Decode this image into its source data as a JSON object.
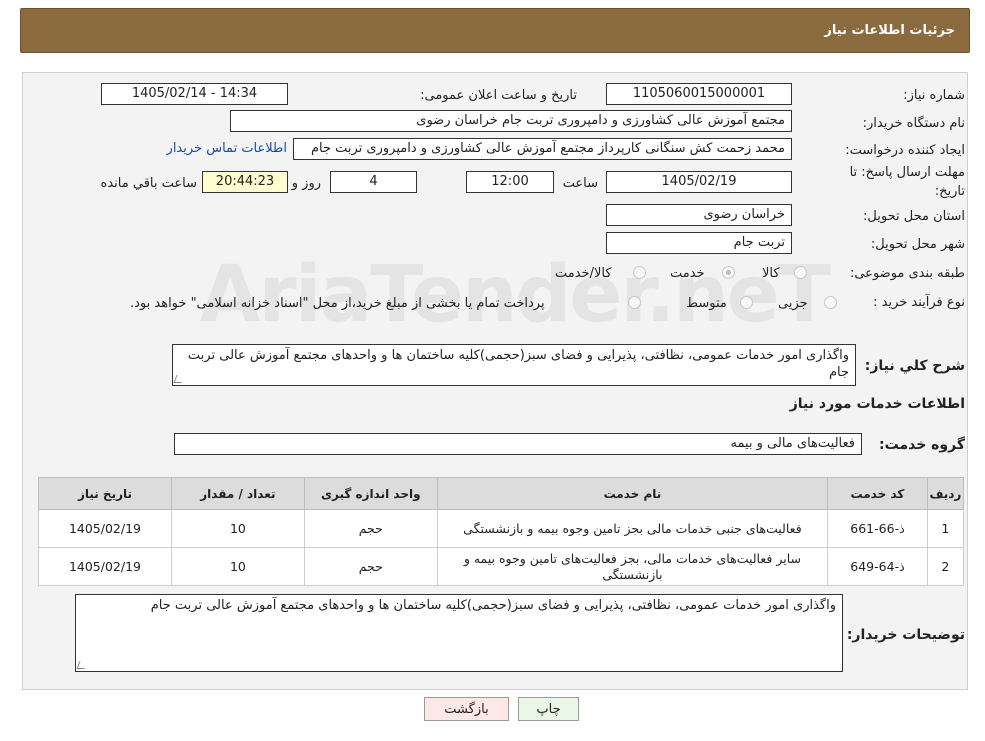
{
  "header": {
    "title": "جزئیات اطلاعات نیاز"
  },
  "fields": {
    "need_number_label": "شماره نیاز:",
    "need_number": "1105060015000001",
    "announce_label": "تاریخ و ساعت اعلان عمومی:",
    "announce_value": "1405/02/14 - 14:34",
    "buyer_label": "نام دستگاه خریدار:",
    "buyer_value": "مجتمع آموزش عالی کشاورزی و دامپروری تربت جام خراسان رضوی",
    "requester_label": "ایجاد کننده درخواست:",
    "requester_value": "محمد زحمت کش سنگانی کارپرداز مجتمع آموزش عالی کشاورزی و دامپروری تربت جام",
    "contact_link": "اطلاعات تماس خریدار",
    "deadline_label_1": "مهلت ارسال پاسخ: تا",
    "deadline_label_2": "تاریخ:",
    "deadline_date": "1405/02/19",
    "time_label": "ساعت",
    "deadline_time": "12:00",
    "days_value": "4",
    "days_label": "روز و",
    "remaining_value": "20:44:23",
    "remaining_label": "ساعت باقي مانده",
    "province_label": "استان محل تحویل:",
    "province_value": "خراسان رضوی",
    "city_label": "شهر محل تحویل:",
    "city_value": "تربت جام",
    "category_label": "طبقه بندی موضوعی:",
    "category_options": [
      "کالا",
      "خدمت",
      "کالا/خدمت"
    ],
    "category_selected": "خدمت",
    "process_label": "نوع فرآیند خرید :",
    "process_options": [
      "جزیی",
      "متوسط"
    ],
    "process_note": "پرداخت تمام یا بخشی از مبلغ خرید،از محل \"اسناد خزانه اسلامی\" خواهد بود.",
    "summary_label": "شرح کلي نیاز:",
    "summary_value": "واگذاری امور خدمات عمومی، نظافتی، پذیرایی و فضای سبز(حجمی)کلیه ساختمان ها و واحدهای مجتمع آموزش عالی تربت جام"
  },
  "services": {
    "section_title": "اطلاعات خدمات مورد نیاز",
    "group_label": "گروه خدمت:",
    "group_value": "فعالیت‌های مالی و بیمه",
    "columns": [
      "ردیف",
      "کد خدمت",
      "نام خدمت",
      "واحد اندازه گیری",
      "تعداد / مقدار",
      "تاریخ نیاز"
    ],
    "rows": [
      {
        "idx": "1",
        "code": "ذ-66-661",
        "name": "فعالیت‌های جنبی خدمات مالی بجز تامین وجوه بیمه و بازنشستگی",
        "unit": "حجم",
        "qty": "10",
        "date": "1405/02/19"
      },
      {
        "idx": "2",
        "code": "ذ-64-649",
        "name": "سایر فعالیت‌های خدمات مالی، بجز فعالیت‌های تامین وجوه بیمه و بازنشستگی",
        "unit": "حجم",
        "qty": "10",
        "date": "1405/02/19"
      }
    ]
  },
  "buyer_notes": {
    "label": "توضیحات خریدار:",
    "value": "واگذاری امور خدمات عمومی، نظافتی، پذیرایی و فضای سبز(حجمی)کلیه ساختمان ها و واحدهای مجتمع آموزش عالی تربت جام"
  },
  "buttons": {
    "print": "چاپ",
    "back": "بازگشت"
  },
  "watermark": "AriaTender.neT",
  "colors": {
    "header": "#8b6a3e",
    "back_button": "#fde8e8",
    "print_button": "#eaf7e6",
    "remaining_box": "#fefcd0",
    "link": "#1a4ea0"
  }
}
